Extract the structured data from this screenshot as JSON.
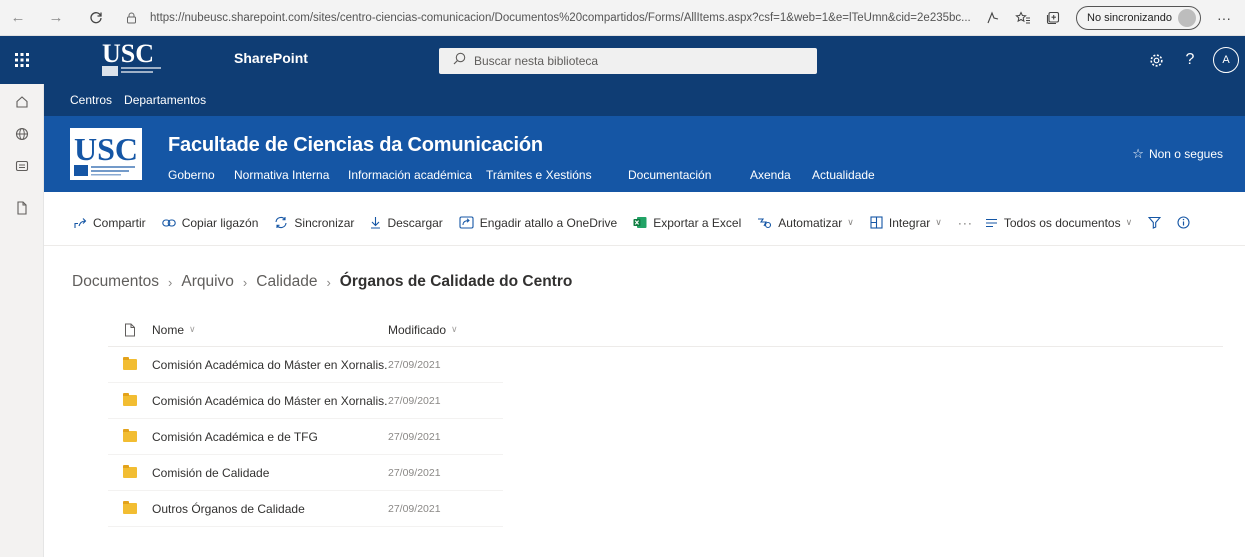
{
  "browser": {
    "url": "https://nubeusc.sharepoint.com/sites/centro-ciencias-comunicacion/Documentos%20compartidos/Forms/AllItems.aspx?csf=1&web=1&e=lTeUmn&cid=2e235bc...",
    "sync_label": "No sincronizando",
    "more": "···"
  },
  "suite": {
    "logo_text": "USC",
    "app_name": "SharePoint",
    "search_placeholder": "Buscar nesta biblioteca",
    "help": "?",
    "avatar_initial": "A"
  },
  "hubnav": {
    "items": [
      "Centros",
      "Departamentos"
    ]
  },
  "site": {
    "logo_text": "USC",
    "title": "Facultade de Ciencias da Comunicación",
    "nav": [
      "Goberno",
      "Normativa Interna",
      "Información académica",
      "Trámites e Xestións",
      "Documentación",
      "Axenda",
      "Actualidade"
    ],
    "follow": "Non o segues"
  },
  "commands": {
    "share": "Compartir",
    "copy_link": "Copiar ligazón",
    "sync": "Sincronizar",
    "download": "Descargar",
    "shortcut": "Engadir atallo a OneDrive",
    "export": "Exportar a Excel",
    "automate": "Automatizar",
    "integrate": "Integrar",
    "more": "···",
    "view": "Todos os documentos"
  },
  "breadcrumb": {
    "items": [
      "Documentos",
      "Arquivo",
      "Calidade"
    ],
    "current": "Órganos de Calidade do Centro"
  },
  "list": {
    "col_name": "Nome",
    "col_modified": "Modificado",
    "rows": [
      {
        "name": "Comisión Académica do Máster en Xornalis...",
        "modified": "27/09/2021"
      },
      {
        "name": "Comisión Académica do Máster en Xornalis...",
        "modified": "27/09/2021"
      },
      {
        "name": "Comisión Académica e de TFG",
        "modified": "27/09/2021"
      },
      {
        "name": "Comisión de Calidade",
        "modified": "27/09/2021"
      },
      {
        "name": "Outros Órganos de Calidade",
        "modified": "27/09/2021"
      }
    ]
  },
  "colors": {
    "suite_bar": "#0f3d74",
    "site_header": "#1556a5",
    "folder": "#f2bd32"
  }
}
